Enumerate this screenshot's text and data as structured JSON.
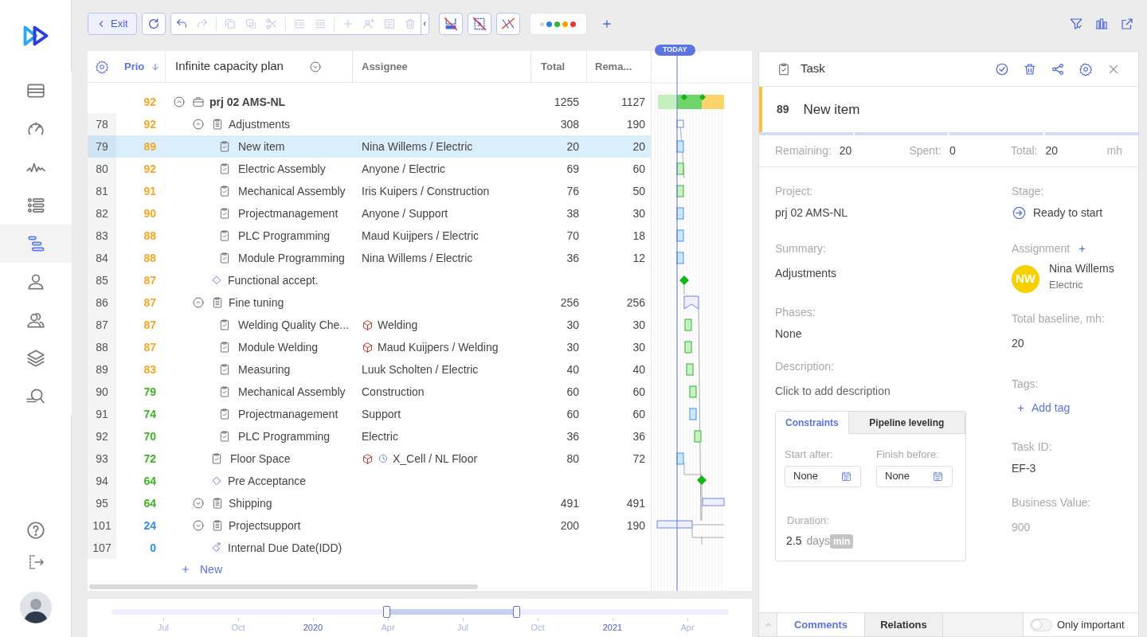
{
  "sidebar": {
    "nav": [
      {
        "selected": false
      },
      {
        "selected": false
      },
      {
        "selected": false
      },
      {
        "selected": false
      },
      {
        "selected": true
      },
      {
        "selected": false
      },
      {
        "selected": false
      },
      {
        "selected": false
      },
      {
        "selected": false
      }
    ]
  },
  "toolbar": {
    "exit": "Exit",
    "edit_tools": [
      {
        "disabled": false
      },
      {
        "disabled": true
      },
      {
        "disabled": true
      },
      {
        "disabled": true
      },
      {
        "disabled": true
      },
      {
        "disabled": true
      },
      {
        "disabled": true
      },
      {
        "disabled": true
      },
      {
        "disabled": true
      },
      {
        "disabled": true
      },
      {
        "disabled": true
      }
    ],
    "color_filter": [
      {
        "color": "#d4d4d4"
      },
      {
        "color": "#1e88e5"
      },
      {
        "color": "#2eb82e"
      },
      {
        "color": "#ffa000"
      },
      {
        "color": "#e53935"
      }
    ]
  },
  "table": {
    "columns": [
      {
        "label": "Prio"
      },
      {
        "label": "Infinite capacity plan"
      },
      {
        "label": "Assignee"
      },
      {
        "label": "Total"
      },
      {
        "label": "Rema..."
      }
    ],
    "rows": [
      {
        "kind": "project",
        "prio": "92",
        "color": "#f5a623",
        "name": "prj 02 AMS-NL",
        "expanded": true,
        "total": "1255",
        "remaining": "1127",
        "selected": false,
        "children": [
          {
            "kind": "group",
            "number": "78",
            "prio": "92",
            "color": "#f5a623",
            "name": "Adjustments",
            "expanded": true,
            "total": "308",
            "remaining": "190",
            "selected": false,
            "children": [
              {
                "kind": "task",
                "number": "79",
                "prio": "89",
                "color": "#f5a623",
                "name": "New item",
                "assignee": {
                  "kind": "person",
                  "text": "Nina Willems / Electric"
                },
                "total": "20",
                "remaining": "20",
                "selected": true
              },
              {
                "kind": "task",
                "number": "80",
                "prio": "92",
                "color": "#f5a623",
                "name": "Electric Assembly",
                "assignee": {
                  "kind": "person",
                  "text": "Anyone / Electric"
                },
                "total": "69",
                "remaining": "60",
                "selected": false
              },
              {
                "kind": "task",
                "number": "81",
                "prio": "91",
                "color": "#f5a623",
                "name": "Mechanical Assembly",
                "assignee": {
                  "kind": "person",
                  "text": "Iris Kuipers / Construction"
                },
                "total": "76",
                "remaining": "50",
                "selected": false
              },
              {
                "kind": "task",
                "number": "82",
                "prio": "90",
                "color": "#f5a623",
                "name": "Projectmanagement",
                "assignee": {
                  "kind": "person",
                  "text": "Anyone / Support"
                },
                "total": "38",
                "remaining": "30",
                "selected": false
              },
              {
                "kind": "task",
                "number": "83",
                "prio": "88",
                "color": "#f5a623",
                "name": "PLC Programming",
                "assignee": {
                  "kind": "person",
                  "text": "Maud Kuijpers / Electric"
                },
                "total": "70",
                "remaining": "18",
                "selected": false
              },
              {
                "kind": "task",
                "number": "84",
                "prio": "88",
                "color": "#f5a623",
                "name": "Module Programming",
                "assignee": {
                  "kind": "person",
                  "text": "Nina Willems / Electric"
                },
                "total": "36",
                "remaining": "12",
                "selected": false
              }
            ]
          },
          {
            "kind": "milestone",
            "number": "85",
            "prio": "87",
            "color": "#f5a623",
            "name": "Functional accept.",
            "selected": false
          },
          {
            "kind": "group",
            "number": "86",
            "prio": "87",
            "color": "#f5a623",
            "name": "Fine tuning",
            "expanded": true,
            "total": "256",
            "remaining": "256",
            "selected": false,
            "children": [
              {
                "kind": "task",
                "number": "87",
                "prio": "87",
                "color": "#f5a623",
                "name": "Welding Quality Che...",
                "assignee": {
                  "kind": "resource",
                  "text": "Welding"
                },
                "total": "30",
                "remaining": "30",
                "selected": false
              },
              {
                "kind": "task",
                "number": "88",
                "prio": "87",
                "color": "#f5a623",
                "name": "Module Welding",
                "assignee": {
                  "kind": "resource",
                  "text": "Maud Kuijpers / Welding"
                },
                "total": "30",
                "remaining": "30",
                "selected": false
              },
              {
                "kind": "task",
                "number": "89",
                "prio": "83",
                "color": "#f5a623",
                "name": "Measuring",
                "assignee": {
                  "kind": "person",
                  "text": "Luuk Scholten / Electric"
                },
                "total": "40",
                "remaining": "40",
                "selected": false
              },
              {
                "kind": "task",
                "number": "90",
                "prio": "79",
                "color": "#3cb521",
                "name": "Mechanical Assembly",
                "assignee": {
                  "kind": "person",
                  "text": "Construction"
                },
                "total": "60",
                "remaining": "60",
                "selected": false
              },
              {
                "kind": "task",
                "number": "91",
                "prio": "74",
                "color": "#3cb521",
                "name": "Projectmanagement",
                "assignee": {
                  "kind": "person",
                  "text": "Support"
                },
                "total": "60",
                "remaining": "60",
                "selected": false
              },
              {
                "kind": "task",
                "number": "92",
                "prio": "70",
                "color": "#3cb521",
                "name": "PLC Programming",
                "assignee": {
                  "kind": "person",
                  "text": "Electric"
                },
                "total": "36",
                "remaining": "36",
                "selected": false
              }
            ]
          },
          {
            "kind": "task",
            "number": "93",
            "prio": "72",
            "color": "#3cb521",
            "name": "Floor Space",
            "assignee": {
              "kind": "timed_resource",
              "text": "X_Cell / NL Floor"
            },
            "total": "80",
            "remaining": "72",
            "selected": false
          },
          {
            "kind": "milestone",
            "number": "94",
            "prio": "64",
            "color": "#3cb521",
            "name": "Pre Acceptance",
            "selected": false
          },
          {
            "kind": "group",
            "number": "95",
            "prio": "64",
            "color": "#3cb521",
            "name": "Shipping",
            "expanded": false,
            "total": "491",
            "remaining": "491",
            "selected": false
          },
          {
            "kind": "group",
            "number": "101",
            "prio": "24",
            "color": "#2f8ef0",
            "name": "Projectsupport",
            "expanded": false,
            "total": "200",
            "remaining": "190",
            "selected": false
          },
          {
            "kind": "due",
            "number": "107",
            "prio": "0",
            "color": "#2f8ef0",
            "name": "Internal Due Date(IDD)",
            "selected": false
          }
        ]
      }
    ],
    "add_row": "New"
  },
  "gantt": {
    "today": "TODAY"
  },
  "timeline": {
    "range": [
      {
        "level": 0.446
      },
      {
        "level": 0.656
      }
    ],
    "labels": [
      {
        "text": "Jul",
        "major": false
      },
      {
        "text": "Oct",
        "major": false
      },
      {
        "text": "2020",
        "major": true
      },
      {
        "text": "Apr",
        "major": false
      },
      {
        "text": "Jul",
        "major": false
      },
      {
        "text": "Oct",
        "major": false
      },
      {
        "text": "2021",
        "major": true
      },
      {
        "text": "Apr",
        "major": false
      }
    ]
  },
  "task_panel": {
    "title": "Task",
    "number": "89",
    "name": "New item",
    "stats": [
      {
        "label": "Remaining:",
        "value": "20"
      },
      {
        "label": "Spent:",
        "value": "0"
      },
      {
        "label": "Total:",
        "value": "20"
      }
    ],
    "unit": "mh",
    "project": {
      "label": "Project:",
      "value": "prj 02 AMS-NL"
    },
    "summary": {
      "label": "Summary:",
      "value": "Adjustments"
    },
    "phases": {
      "label": "Phases:",
      "value": "None"
    },
    "description": {
      "label": "Description:",
      "placeholder": "Click to add description"
    },
    "constraint_tabs": [
      {
        "label": "Constraints",
        "selected": true
      },
      {
        "label": "Pipeline leveling",
        "selected": false
      }
    ],
    "start_after": {
      "label": "Start after:",
      "value": "None"
    },
    "finish_before": {
      "label": "Finish before:",
      "value": "None"
    },
    "duration": {
      "label": "Duration:",
      "value": "2.5",
      "unit": "days",
      "badge": "min"
    },
    "stage": {
      "label": "Stage:",
      "value": "Ready to start"
    },
    "assignment": {
      "label": "Assignment",
      "initials": "NW",
      "name": "Nina Willems",
      "team": "Electric"
    },
    "baseline": {
      "label": "Total baseline, mh:",
      "value": "20"
    },
    "tags": {
      "label": "Tags:",
      "action": "Add tag"
    },
    "task_id": {
      "label": "Task ID:",
      "value": "EF-3"
    },
    "business_value": {
      "label": "Business Value:",
      "value": "900"
    },
    "bottom_tabs": [
      {
        "label": "Comments",
        "selected": true
      },
      {
        "label": "Relations",
        "selected": false
      }
    ],
    "only_important": {
      "label": "Only important",
      "on": false
    }
  }
}
